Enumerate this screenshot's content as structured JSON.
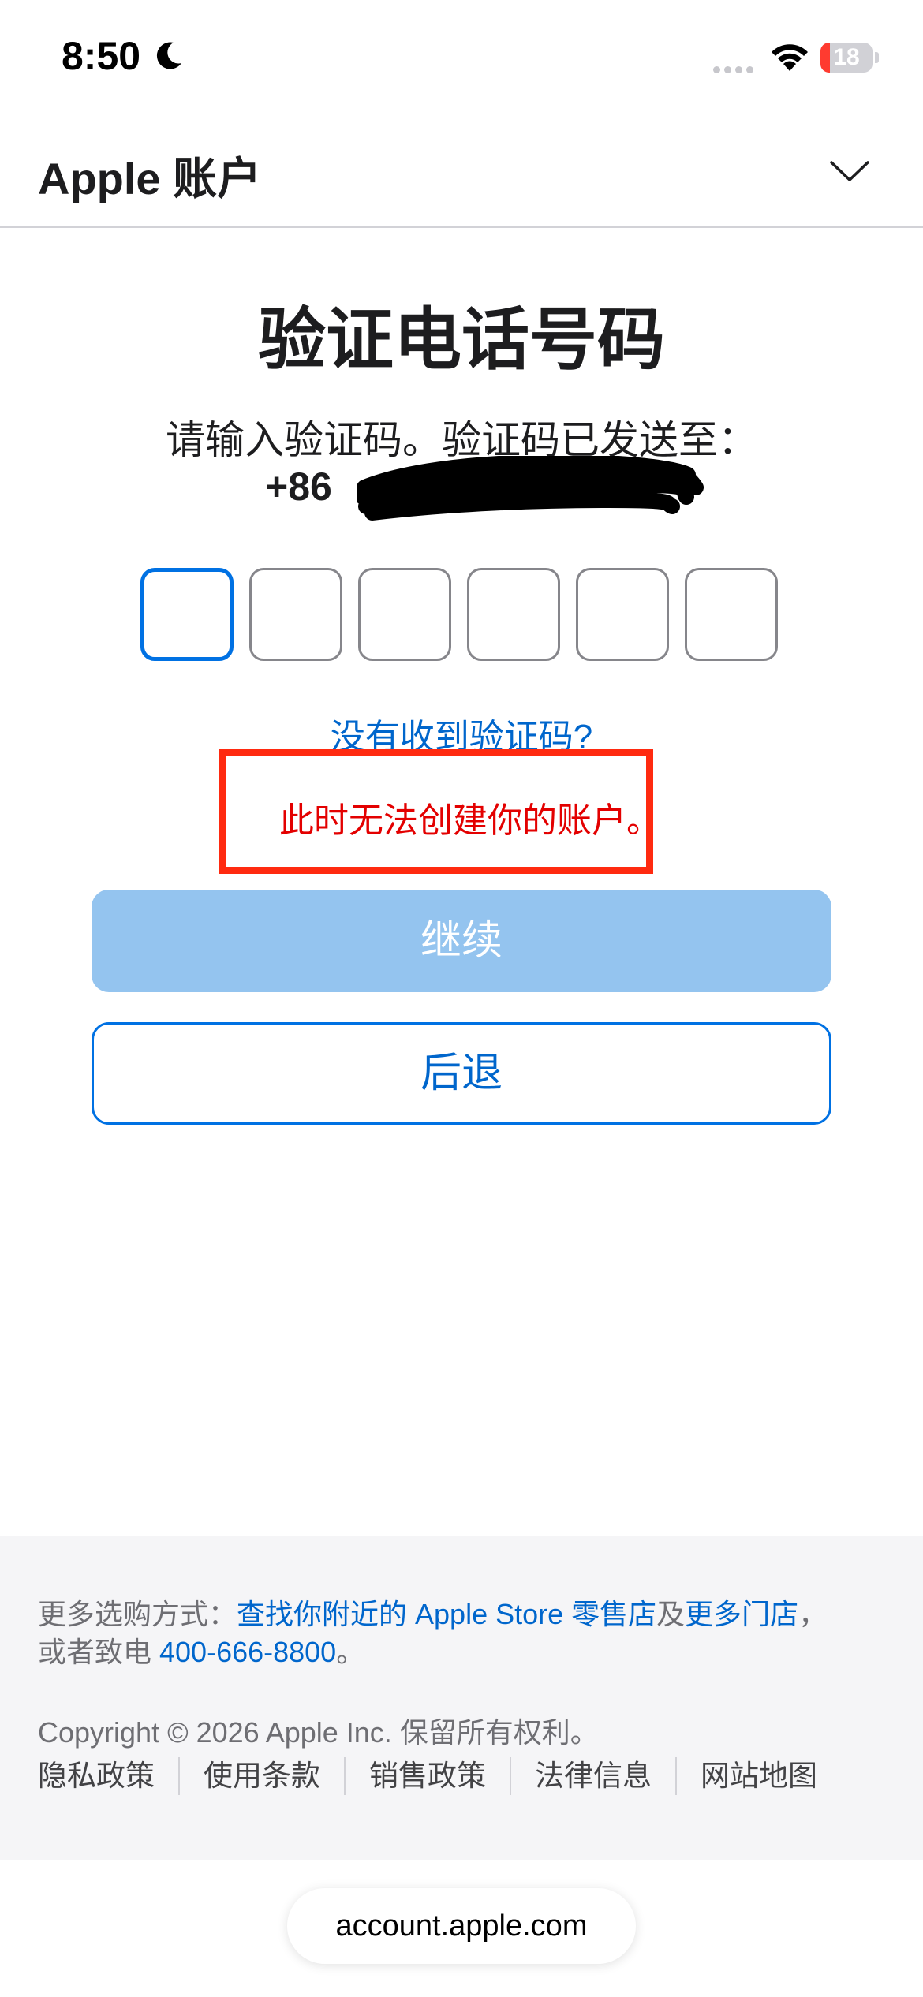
{
  "status_bar": {
    "time": "8:50",
    "battery_level": "18",
    "icons": [
      "moon-icon",
      "signal-icon",
      "wifi-icon",
      "battery-icon"
    ]
  },
  "header": {
    "title": "Apple 账户",
    "menu_icon": "chevron-down-icon"
  },
  "main": {
    "title": "验证电话号码",
    "instruction": "请输入验证码。验证码已发送至：",
    "phone_prefix": "+86",
    "code_length": 6,
    "resend_link": "没有收到验证码?",
    "error_message": "此时无法创建你的账户。",
    "continue_label": "继续",
    "back_label": "后退"
  },
  "footer": {
    "shop_prefix": "更多选购方式：",
    "find_store_link": "查找你附近的 Apple Store 零售店",
    "and_text": "及",
    "more_stores_link": "更多门店",
    "comma": "，",
    "call_prefix": "或者致电 ",
    "phone_link": "400-666-8800",
    "period": "。",
    "copyright": "Copyright © 2026 Apple Inc. 保留所有权利。",
    "links": [
      "隐私政策",
      "使用条款",
      "销售政策",
      "法律信息",
      "网站地图"
    ]
  },
  "browser": {
    "url": "account.apple.com"
  },
  "colors": {
    "accent": "#0066cc",
    "error": "#e30000",
    "error_highlight": "#ff2a10",
    "button_disabled": "#94c4ef"
  }
}
